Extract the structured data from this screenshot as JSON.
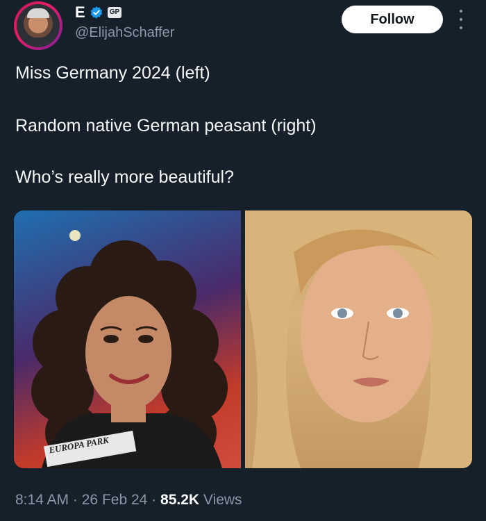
{
  "author": {
    "display_name": "E",
    "affiliate_badge": "GP",
    "handle": "@ElijahSchaffer",
    "verified": true
  },
  "follow_label": "Follow",
  "tweet": {
    "lines": [
      "Miss Germany 2024 (left)",
      "Random native German peasant (right)",
      "Who’s really more beautiful?"
    ]
  },
  "media": {
    "left_sash_text": "EUROPA PARK"
  },
  "meta": {
    "time": "8:14 AM",
    "separator": "·",
    "date": "26 Feb 24",
    "views_count": "85.2K",
    "views_label": "Views"
  },
  "colors": {
    "background": "#15202b",
    "verified_blue": "#1d9bf0",
    "muted_text": "#8b98a5"
  }
}
